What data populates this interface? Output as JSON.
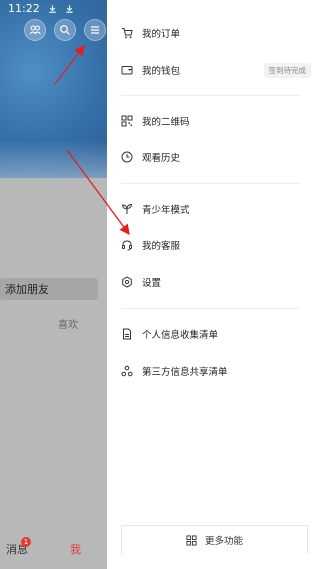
{
  "status_bar": {
    "time": "11:22"
  },
  "left_panel": {
    "add_friend_label": "添加朋友",
    "like_label": "喜欢",
    "nav": {
      "messages": "消息",
      "messages_badge": "1",
      "me": "我"
    }
  },
  "drawer": {
    "items": [
      {
        "label": "我的订单"
      },
      {
        "label": "我的钱包",
        "tag": "签到待完成"
      },
      {
        "label": "我的二维码"
      },
      {
        "label": "观看历史"
      },
      {
        "label": "青少年模式"
      },
      {
        "label": "我的客服"
      },
      {
        "label": "设置"
      },
      {
        "label": "个人信息收集清单"
      },
      {
        "label": "第三方信息共享清单"
      }
    ],
    "more_label": "更多功能"
  },
  "colors": {
    "accent": "#e53935",
    "arrow": "#e02020",
    "panel_blue": "#356fa8"
  }
}
